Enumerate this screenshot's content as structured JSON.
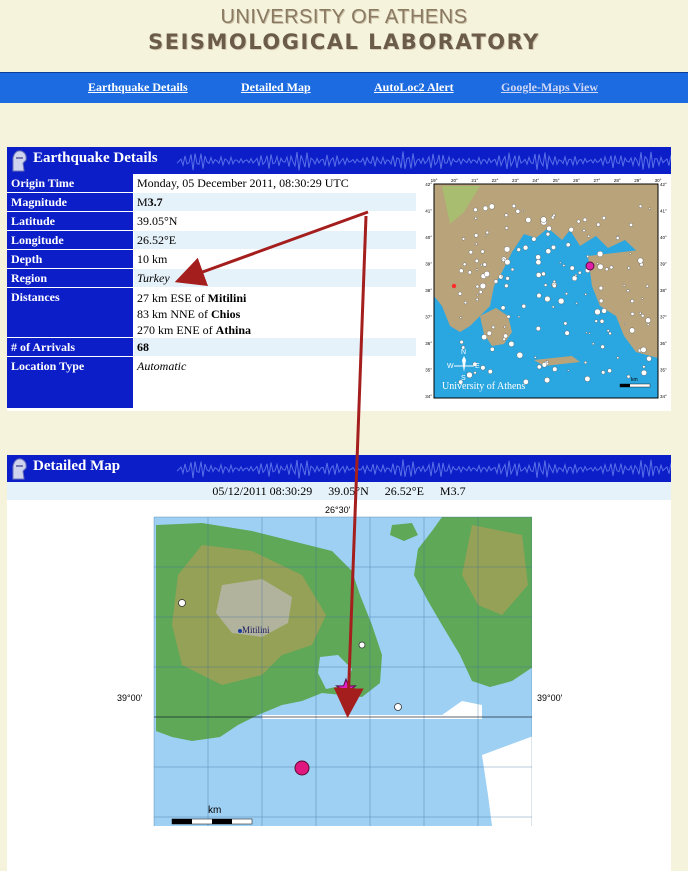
{
  "header": {
    "line1": "UNIVERSITY OF ATHENS",
    "line2": "SEISMOLOGICAL LABORATORY"
  },
  "nav": {
    "items": [
      {
        "label": "Earthquake Details"
      },
      {
        "label": "Detailed Map"
      },
      {
        "label": "AutoLoc2 Alert"
      },
      {
        "label": "Google-Maps View"
      }
    ]
  },
  "details": {
    "title": "Earthquake Details",
    "rows": [
      {
        "label": "Origin Time",
        "value": "Monday, 05 December 2011, 08:30:29 UTC"
      },
      {
        "label": "Magnitude",
        "prefix": "M",
        "value": "3.7"
      },
      {
        "label": "Latitude",
        "value": "39.05°N"
      },
      {
        "label": "Longitude",
        "value": "26.52°E"
      },
      {
        "label": "Depth",
        "value": "10 km"
      },
      {
        "label": "Region",
        "value": "Turkey"
      },
      {
        "label": "Distances",
        "lines": [
          {
            "text": "27 km ESE of ",
            "place": "Mitilini"
          },
          {
            "text": "83 km NNE of ",
            "place": "Chios"
          },
          {
            "text": "270 km ENE of ",
            "place": "Athina"
          }
        ]
      },
      {
        "label": "# of Arrivals",
        "value": "68"
      },
      {
        "label": "Location Type",
        "value": "Automatic"
      }
    ]
  },
  "overview_map": {
    "credit": "University of Athens",
    "top_ticks": [
      "19°",
      "20°",
      "21°",
      "22°",
      "23°",
      "24°",
      "25°",
      "26°",
      "27°",
      "28°",
      "29°",
      "30°"
    ],
    "left_ticks": [
      "42°",
      "41°",
      "40°",
      "39°",
      "38°",
      "37°",
      "36°",
      "35°",
      "34°"
    ],
    "right_ticks": [
      "42°",
      "41°",
      "40°",
      "39°",
      "38°",
      "37°",
      "36°",
      "35°",
      "34°"
    ],
    "compass": {
      "n": "N",
      "s": "S",
      "e": "E",
      "w": "W"
    },
    "scale_label": "km",
    "colors": {
      "sea": "#2aa6e0",
      "land": "#b9a37a",
      "event": "#e01fa6"
    }
  },
  "detailed_map": {
    "title": "Detailed Map",
    "caption": {
      "date": "05/12/2011 08:30:29",
      "lat": "39.05°N",
      "lon": "26.52°E",
      "mag": "M3.7"
    },
    "top_tick": "26°30'",
    "left_tick": "39°00'",
    "right_tick": "39°00'",
    "city": "Mitilini",
    "scale_label": "km",
    "colors": {
      "sea": "#9ed0f3",
      "land": "#5ea858",
      "event_star": "#e21ec0",
      "event_dot": "#e0177f"
    }
  },
  "annotations": {
    "arrow_color": "#a51e1e"
  }
}
